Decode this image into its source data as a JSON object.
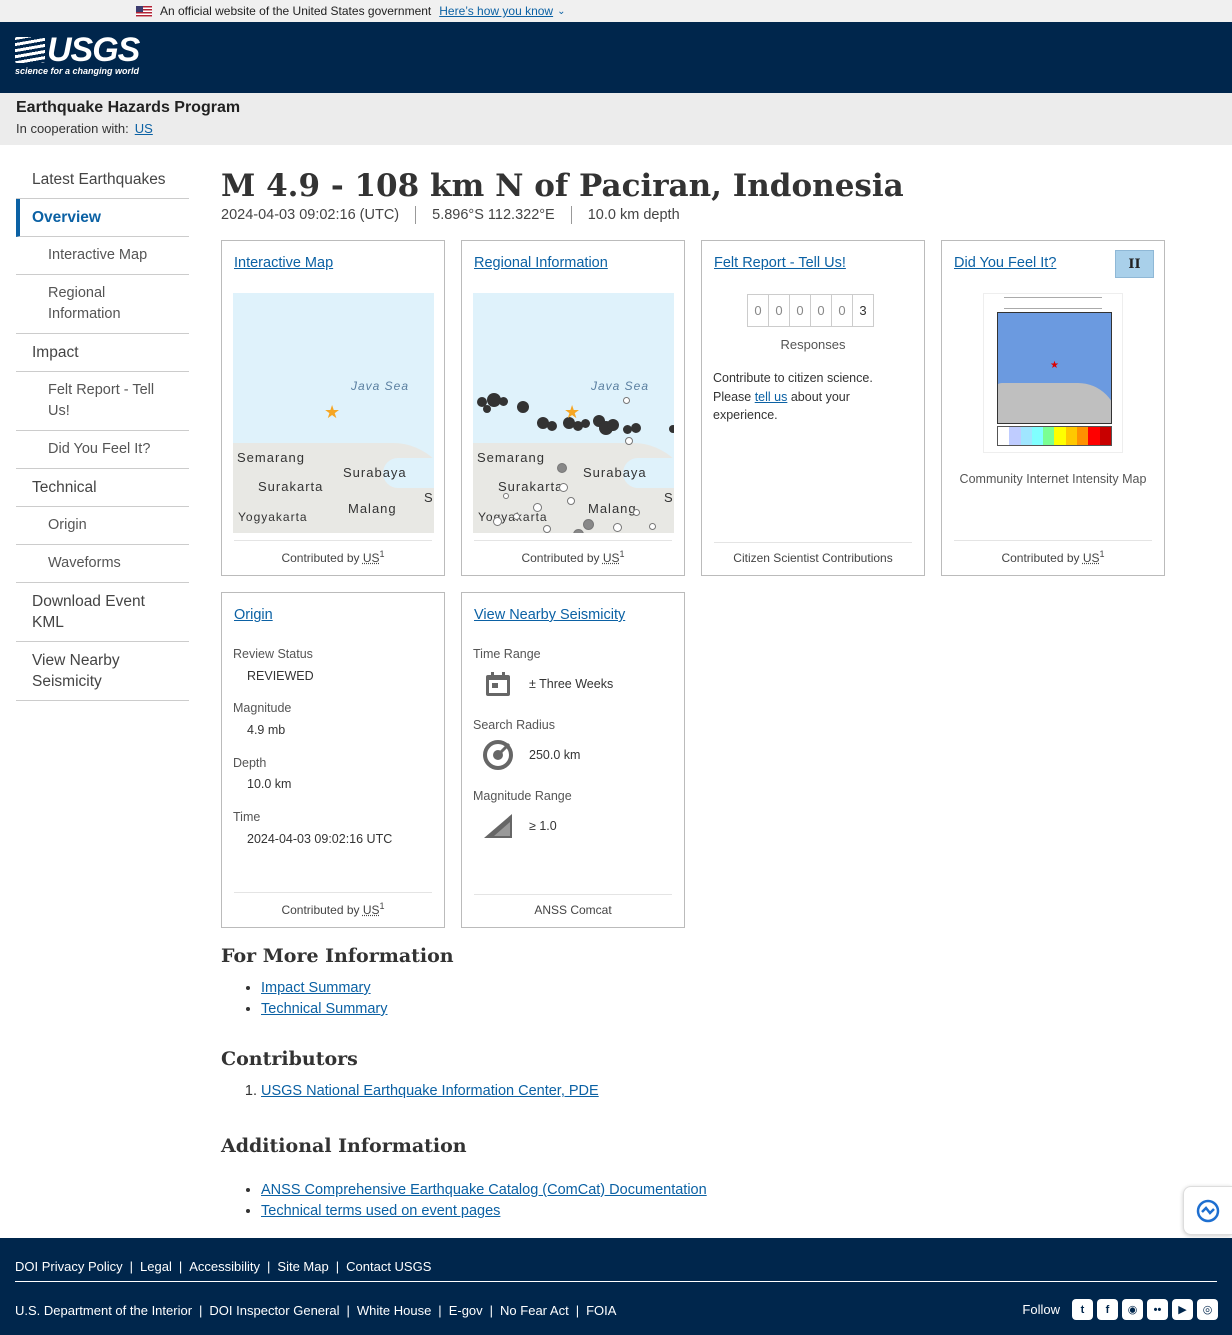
{
  "gov_banner": {
    "text": "An official website of the United States government",
    "link": "Here’s how you know"
  },
  "header": {
    "logo_word": "USGS",
    "logo_tagline": "science for a changing world"
  },
  "program": {
    "name": "Earthquake Hazards Program",
    "coop_label": "In cooperation with:",
    "coop_link": "US"
  },
  "sidenav": {
    "items": [
      {
        "label": "Latest Earthquakes"
      },
      {
        "label": "Overview"
      },
      {
        "label": "Interactive Map"
      },
      {
        "label": "Regional Information"
      },
      {
        "label": "Impact"
      },
      {
        "label": "Felt Report - Tell Us!"
      },
      {
        "label": "Did You Feel It?"
      },
      {
        "label": "Technical"
      },
      {
        "label": "Origin"
      },
      {
        "label": "Waveforms"
      },
      {
        "label": "Download Event KML"
      },
      {
        "label": "View Nearby Seismicity"
      }
    ]
  },
  "event": {
    "title": "M 4.9 - 108 km N of Paciran, Indonesia",
    "time": "2024-04-03 09:02:16 (UTC)",
    "location": "5.896°S 112.322°E",
    "depth": "10.0 km depth"
  },
  "cards": {
    "interactive_map": {
      "title": "Interactive Map",
      "sea": "Java Sea",
      "cities": [
        "Semarang",
        "Surabaya",
        "Surakarta",
        "Malang",
        "Yogyakarta",
        "S"
      ],
      "footer_prefix": "Contributed by",
      "footer_net": "US",
      "footer_sup": "1"
    },
    "regional": {
      "title": "Regional Information",
      "sea": "Java Sea",
      "cities": [
        "Semarang",
        "Surabaya",
        "Surakarta",
        "Malang",
        "Yogyakarta",
        "S"
      ],
      "footer_prefix": "Contributed by",
      "footer_net": "US",
      "footer_sup": "1"
    },
    "felt": {
      "title": "Felt Report - Tell Us!",
      "digits": [
        "0",
        "0",
        "0",
        "0",
        "0",
        "3"
      ],
      "responses": "Responses",
      "text_before": "Contribute to citizen science. Please ",
      "link": "tell us",
      "text_after": " about your experience.",
      "footer": "Citizen Scientist Contributions"
    },
    "dyfi": {
      "title": "Did You Feel It?",
      "mmi": "II",
      "mmi_color": "#a9d0ea",
      "caption": "Community Internet Intensity Map",
      "footer_prefix": "Contributed by",
      "footer_net": "US",
      "footer_sup": "1"
    },
    "origin": {
      "title": "Origin",
      "fields": [
        {
          "label": "Review Status",
          "value": "REVIEWED"
        },
        {
          "label": "Magnitude",
          "value": "4.9 mb"
        },
        {
          "label": "Depth",
          "value": "10.0 km"
        },
        {
          "label": "Time",
          "value": "2024-04-03 09:02:16 UTC"
        }
      ],
      "footer_prefix": "Contributed by",
      "footer_net": "US",
      "footer_sup": "1"
    },
    "seismicity": {
      "title": "View Nearby Seismicity",
      "rows": [
        {
          "label": "Time Range",
          "value": "± Three Weeks",
          "icon": "calendar-icon"
        },
        {
          "label": "Search Radius",
          "value": "250.0 km",
          "icon": "radius-icon"
        },
        {
          "label": "Magnitude Range",
          "value": "≥ 1.0",
          "icon": "magnitude-icon"
        }
      ],
      "footer": "ANSS Comcat"
    }
  },
  "more_info": {
    "title": "For More Information",
    "links": [
      "Impact Summary",
      "Technical Summary"
    ]
  },
  "contributors": {
    "title": "Contributors",
    "items": [
      "USGS National Earthquake Information Center, PDE"
    ]
  },
  "additional": {
    "title": "Additional Information",
    "links": [
      "ANSS Comprehensive Earthquake Catalog (ComCat) Documentation",
      "Technical terms used on event pages"
    ]
  },
  "footer": {
    "row1": [
      "DOI Privacy Policy",
      "Legal",
      "Accessibility",
      "Site Map",
      "Contact USGS"
    ],
    "row2": [
      "U.S. Department of the Interior",
      "DOI Inspector General",
      "White House",
      "E-gov",
      "No Fear Act",
      "FOIA"
    ],
    "follow": "Follow",
    "social": [
      "twitter-icon",
      "facebook-icon",
      "github-icon",
      "flickr-icon",
      "youtube-icon",
      "instagram-icon"
    ]
  }
}
